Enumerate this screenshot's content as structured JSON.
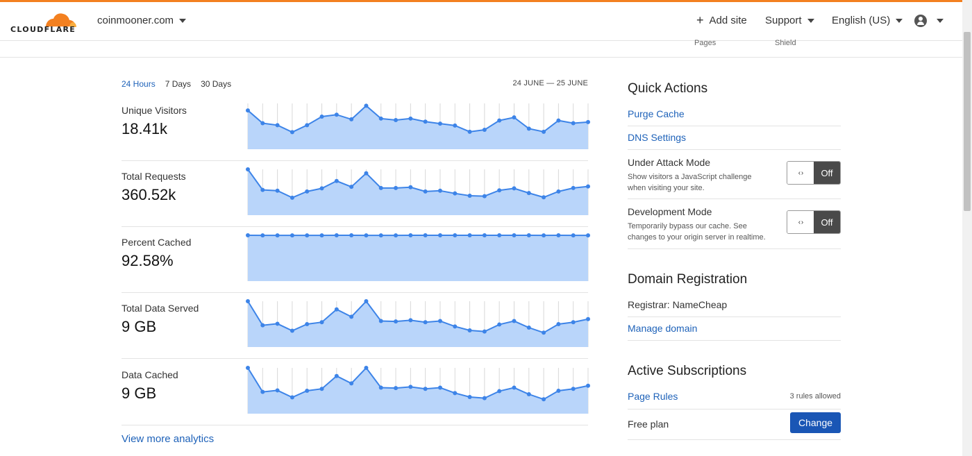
{
  "header": {
    "logo_text": "CLOUDFLARE",
    "domain": "coinmooner.com",
    "add_site": "Add site",
    "support": "Support",
    "language": "English (US)"
  },
  "subtabs": {
    "pages": "Pages",
    "shield": "Shield"
  },
  "analytics": {
    "ranges": [
      "24 Hours",
      "7 Days",
      "30 Days"
    ],
    "active_range": "24 Hours",
    "date_range": "24 JUNE — 25 JUNE",
    "view_more": "View more analytics"
  },
  "chart_data": [
    {
      "type": "area",
      "title": "Unique Visitors",
      "summary": "18.41k",
      "values": [
        100,
        67,
        62,
        44,
        62,
        84,
        89,
        77,
        112,
        79,
        75,
        79,
        71,
        66,
        61,
        45,
        50,
        74,
        82,
        53,
        45,
        74,
        67,
        70
      ]
    },
    {
      "type": "area",
      "title": "Total Requests",
      "summary": "360.52k",
      "values": [
        118,
        65,
        63,
        45,
        61,
        69,
        88,
        73,
        108,
        70,
        70,
        72,
        61,
        63,
        56,
        50,
        49,
        64,
        69,
        57,
        46,
        61,
        70,
        74
      ]
    },
    {
      "type": "area",
      "title": "Percent Cached",
      "summary": "92.58%",
      "values": [
        92.6,
        92.5,
        92.55,
        92.55,
        92.55,
        92.5,
        92.6,
        92.6,
        92.55,
        92.55,
        92.55,
        92.6,
        92.65,
        92.65,
        92.6,
        92.6,
        92.6,
        92.6,
        92.65,
        92.6,
        92.55,
        92.6,
        92.5,
        92.5
      ]
    },
    {
      "type": "area",
      "title": "Total Data Served",
      "summary": "9 GB",
      "values": [
        118,
        56,
        60,
        42,
        59,
        64,
        97,
        78,
        118,
        67,
        66,
        69,
        64,
        67,
        53,
        43,
        40,
        58,
        67,
        50,
        37,
        59,
        64,
        72
      ]
    },
    {
      "type": "area",
      "title": "Data Cached",
      "summary": "9 GB",
      "values": [
        118,
        56,
        60,
        42,
        59,
        64,
        97,
        78,
        118,
        67,
        66,
        69,
        64,
        67,
        53,
        43,
        40,
        58,
        67,
        50,
        37,
        59,
        64,
        72
      ]
    }
  ],
  "quick_actions": {
    "title": "Quick Actions",
    "purge_cache": "Purge Cache",
    "dns_settings": "DNS Settings",
    "under_attack": {
      "label": "Under Attack Mode",
      "desc": "Show visitors a JavaScript challenge when visiting your site.",
      "state": "Off",
      "knob": "‹ ›"
    },
    "dev_mode": {
      "label": "Development Mode",
      "desc": "Temporarily bypass our cache. See changes to your origin server in realtime.",
      "state": "Off",
      "knob": "‹ ›"
    }
  },
  "domain_registration": {
    "title": "Domain Registration",
    "registrar": "Registrar: NameCheap",
    "manage": "Manage domain"
  },
  "subscriptions": {
    "title": "Active Subscriptions",
    "page_rules": "Page Rules",
    "rules_allowed": "3 rules allowed",
    "plan": "Free plan",
    "change": "Change"
  },
  "colors": {
    "accent": "#1e62b9",
    "brand_orange": "#f38020",
    "area_fill": "#b9d5fa",
    "line": "#3d84e8"
  }
}
